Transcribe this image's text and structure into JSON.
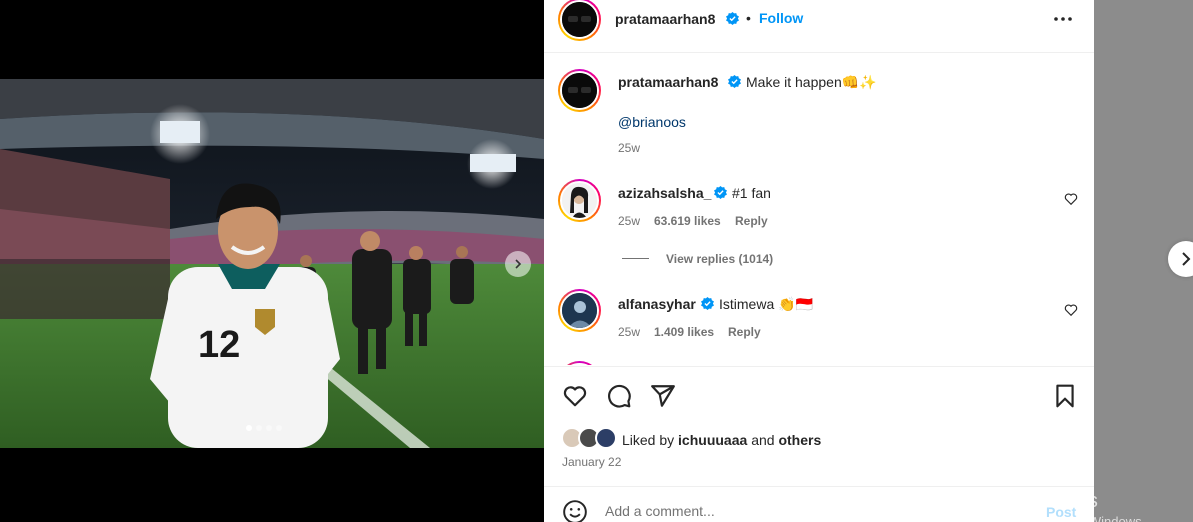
{
  "post": {
    "author": "pratamaarhan8",
    "follow_dot": "•",
    "follow_label": "Follow",
    "caption": {
      "username": "pratamaarhan8",
      "text": "Make it happen👊✨",
      "mention": "@brianoos",
      "age": "25w"
    },
    "carousel": {
      "slides": 4,
      "active": 1
    }
  },
  "comments": [
    {
      "username": "azizahsalsha_",
      "text": "#1 fan",
      "age": "25w",
      "likes": "63.619 likes",
      "reply": "Reply",
      "view_replies": "View replies (1014)"
    },
    {
      "username": "alfanasyhar",
      "text": "Istimewa 👏🇮🇩",
      "age": "25w",
      "likes": "1.409 likes",
      "reply": "Reply"
    }
  ],
  "likes": {
    "prefix": "Liked by",
    "user": "ichuuuaaa",
    "and": "and",
    "others": "others",
    "date": "January 22"
  },
  "add_comment": {
    "placeholder": "Add a comment...",
    "post_label": "Post"
  },
  "watermark": {
    "title": "Activate Windows",
    "subtitle": "Go to Settings to activate Windows."
  },
  "colors": {
    "link": "#0095f6",
    "verified": "#0095f6",
    "mention": "#00376b"
  }
}
